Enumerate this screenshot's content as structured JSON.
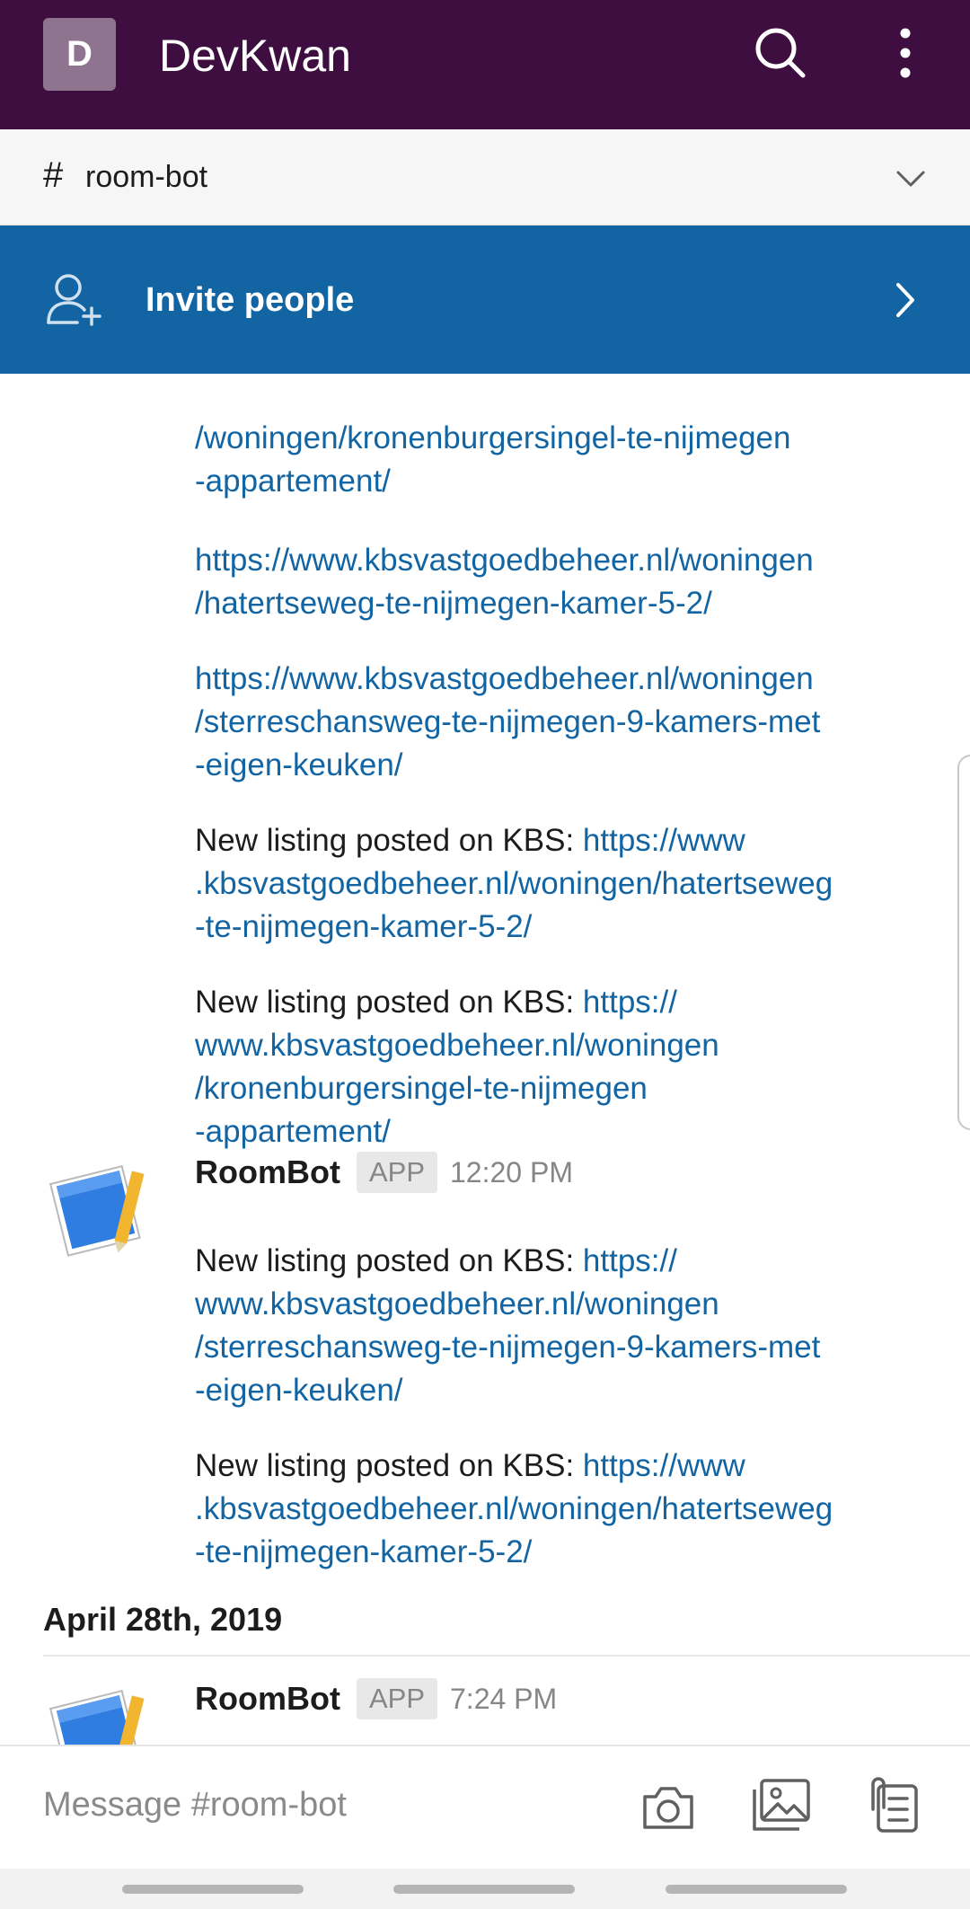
{
  "workspace": {
    "initial": "D",
    "name": "DevKwan"
  },
  "channel": {
    "hash": "#",
    "name": "room-bot"
  },
  "invite": {
    "label": "Invite people"
  },
  "messages": {
    "frag1_link": "/woningen/kronenburgersingel-te-nijmegen\n-appartement/",
    "frag2_link": "https://www.kbsvastgoedbeheer.nl/woningen\n/hatertseweg-te-nijmegen-kamer-5-2/",
    "frag3_link": "https://www.kbsvastgoedbeheer.nl/woningen\n/sterreschansweg-te-nijmegen-9-kamers-met\n-eigen-keuken/",
    "m1_prefix": "New listing posted on KBS: ",
    "m1_link": "https://www\n.kbsvastgoedbeheer.nl/woningen/hatertseweg\n-te-nijmegen-kamer-5-2/",
    "m2_prefix": "New listing posted on KBS: ",
    "m2_link": "https://\nwww.kbsvastgoedbeheer.nl/woningen\n/kronenburgersingel-te-nijmegen\n-appartement/",
    "block2": {
      "sender": "RoomBot",
      "badge": "APP",
      "time": "12:20 PM",
      "m3_prefix": "New listing posted on KBS: ",
      "m3_link": "https://\nwww.kbsvastgoedbeheer.nl/woningen\n/sterreschansweg-te-nijmegen-9-kamers-met\n-eigen-keuken/",
      "m4_prefix": "New listing posted on KBS: ",
      "m4_link": "https://www\n.kbsvastgoedbeheer.nl/woningen/hatertseweg\n-te-nijmegen-kamer-5-2/"
    },
    "date_divider": "April 28th, 2019",
    "block3": {
      "sender": "RoomBot",
      "badge": "APP",
      "time": "7:24 PM"
    }
  },
  "composer": {
    "placeholder": "Message #room-bot"
  }
}
